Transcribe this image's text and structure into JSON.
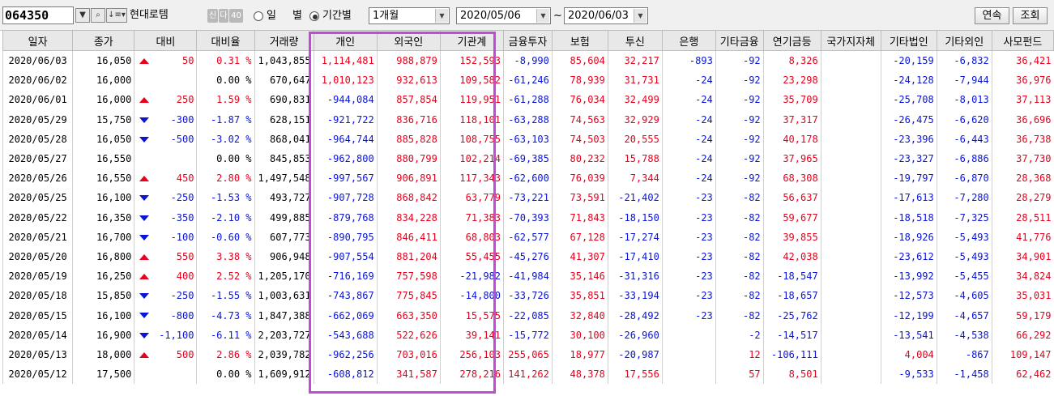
{
  "toolbar": {
    "stock_code": "064350",
    "stock_name": "현대로템",
    "badge_credit": "신",
    "badge_other": "다",
    "badge_margin": "40",
    "radio_daily": "일",
    "radio_daily_suffix": "별",
    "radio_period": "기간별",
    "period_select": "1개월",
    "date_from": "2020/05/06",
    "date_sep": "~",
    "date_to": "2020/06/03",
    "continue_label": "연속",
    "query_label": "조회"
  },
  "columns": [
    "일자",
    "종가",
    "대비",
    "대비율",
    "거래량",
    "개인",
    "외국인",
    "기관계",
    "금융투자",
    "보험",
    "투신",
    "은행",
    "기타금융",
    "연기금등",
    "국가지자체",
    "기타법인",
    "기타외인",
    "사모펀드"
  ],
  "colors": {
    "up": "#e8001c",
    "down": "#0a14d8",
    "highlight": "#c24ad7"
  },
  "rows": [
    {
      "date": "2020/06/03",
      "close": "16,050",
      "dir": "up",
      "diff": "50",
      "rate": "0.31 %",
      "volume": "1,043,855",
      "indiv": "1,114,481",
      "foreign": "988,879",
      "inst": "152,593",
      "fininv": "-8,990",
      "insur": "85,604",
      "trust": "32,217",
      "bank": "-893",
      "etcfin": "-92",
      "pension": "8,326",
      "govt": "",
      "etccorp": "-20,159",
      "etcfor": "-6,832",
      "pef": "36,421"
    },
    {
      "date": "2020/06/02",
      "close": "16,000",
      "dir": "none",
      "diff": "",
      "rate": "0.00 %",
      "volume": "670,647",
      "indiv": "1,010,123",
      "foreign": "932,613",
      "inst": "109,582",
      "fininv": "-61,246",
      "insur": "78,939",
      "trust": "31,731",
      "bank": "-24",
      "etcfin": "-92",
      "pension": "23,298",
      "govt": "",
      "etccorp": "-24,128",
      "etcfor": "-7,944",
      "pef": "36,976"
    },
    {
      "date": "2020/06/01",
      "close": "16,000",
      "dir": "up",
      "diff": "250",
      "rate": "1.59 %",
      "volume": "690,831",
      "indiv": "-944,084",
      "foreign": "857,854",
      "inst": "119,951",
      "fininv": "-61,288",
      "insur": "76,034",
      "trust": "32,499",
      "bank": "-24",
      "etcfin": "-92",
      "pension": "35,709",
      "govt": "",
      "etccorp": "-25,708",
      "etcfor": "-8,013",
      "pef": "37,113"
    },
    {
      "date": "2020/05/29",
      "close": "15,750",
      "dir": "down",
      "diff": "-300",
      "rate": "-1.87 %",
      "volume": "628,151",
      "indiv": "-921,722",
      "foreign": "836,716",
      "inst": "118,101",
      "fininv": "-63,288",
      "insur": "74,563",
      "trust": "32,929",
      "bank": "-24",
      "etcfin": "-92",
      "pension": "37,317",
      "govt": "",
      "etccorp": "-26,475",
      "etcfor": "-6,620",
      "pef": "36,696"
    },
    {
      "date": "2020/05/28",
      "close": "16,050",
      "dir": "down",
      "diff": "-500",
      "rate": "-3.02 %",
      "volume": "868,041",
      "indiv": "-964,744",
      "foreign": "885,828",
      "inst": "108,755",
      "fininv": "-63,103",
      "insur": "74,503",
      "trust": "20,555",
      "bank": "-24",
      "etcfin": "-92",
      "pension": "40,178",
      "govt": "",
      "etccorp": "-23,396",
      "etcfor": "-6,443",
      "pef": "36,738"
    },
    {
      "date": "2020/05/27",
      "close": "16,550",
      "dir": "none",
      "diff": "",
      "rate": "0.00 %",
      "volume": "845,853",
      "indiv": "-962,800",
      "foreign": "880,799",
      "inst": "102,214",
      "fininv": "-69,385",
      "insur": "80,232",
      "trust": "15,788",
      "bank": "-24",
      "etcfin": "-92",
      "pension": "37,965",
      "govt": "",
      "etccorp": "-23,327",
      "etcfor": "-6,886",
      "pef": "37,730"
    },
    {
      "date": "2020/05/26",
      "close": "16,550",
      "dir": "up",
      "diff": "450",
      "rate": "2.80 %",
      "volume": "1,497,548",
      "indiv": "-997,567",
      "foreign": "906,891",
      "inst": "117,343",
      "fininv": "-62,600",
      "insur": "76,039",
      "trust": "7,344",
      "bank": "-24",
      "etcfin": "-92",
      "pension": "68,308",
      "govt": "",
      "etccorp": "-19,797",
      "etcfor": "-6,870",
      "pef": "28,368"
    },
    {
      "date": "2020/05/25",
      "close": "16,100",
      "dir": "down",
      "diff": "-250",
      "rate": "-1.53 %",
      "volume": "493,727",
      "indiv": "-907,728",
      "foreign": "868,842",
      "inst": "63,779",
      "fininv": "-73,221",
      "insur": "73,591",
      "trust": "-21,402",
      "bank": "-23",
      "etcfin": "-82",
      "pension": "56,637",
      "govt": "",
      "etccorp": "-17,613",
      "etcfor": "-7,280",
      "pef": "28,279"
    },
    {
      "date": "2020/05/22",
      "close": "16,350",
      "dir": "down",
      "diff": "-350",
      "rate": "-2.10 %",
      "volume": "499,885",
      "indiv": "-879,768",
      "foreign": "834,228",
      "inst": "71,383",
      "fininv": "-70,393",
      "insur": "71,843",
      "trust": "-18,150",
      "bank": "-23",
      "etcfin": "-82",
      "pension": "59,677",
      "govt": "",
      "etccorp": "-18,518",
      "etcfor": "-7,325",
      "pef": "28,511"
    },
    {
      "date": "2020/05/21",
      "close": "16,700",
      "dir": "down",
      "diff": "-100",
      "rate": "-0.60 %",
      "volume": "607,773",
      "indiv": "-890,795",
      "foreign": "846,411",
      "inst": "68,803",
      "fininv": "-62,577",
      "insur": "67,128",
      "trust": "-17,274",
      "bank": "-23",
      "etcfin": "-82",
      "pension": "39,855",
      "govt": "",
      "etccorp": "-18,926",
      "etcfor": "-5,493",
      "pef": "41,776"
    },
    {
      "date": "2020/05/20",
      "close": "16,800",
      "dir": "up",
      "diff": "550",
      "rate": "3.38 %",
      "volume": "906,948",
      "indiv": "-907,554",
      "foreign": "881,204",
      "inst": "55,455",
      "fininv": "-45,276",
      "insur": "41,307",
      "trust": "-17,410",
      "bank": "-23",
      "etcfin": "-82",
      "pension": "42,038",
      "govt": "",
      "etccorp": "-23,612",
      "etcfor": "-5,493",
      "pef": "34,901"
    },
    {
      "date": "2020/05/19",
      "close": "16,250",
      "dir": "up",
      "diff": "400",
      "rate": "2.52 %",
      "volume": "1,205,170",
      "indiv": "-716,169",
      "foreign": "757,598",
      "inst": "-21,982",
      "fininv": "-41,984",
      "insur": "35,146",
      "trust": "-31,316",
      "bank": "-23",
      "etcfin": "-82",
      "pension": "-18,547",
      "govt": "",
      "etccorp": "-13,992",
      "etcfor": "-5,455",
      "pef": "34,824"
    },
    {
      "date": "2020/05/18",
      "close": "15,850",
      "dir": "down",
      "diff": "-250",
      "rate": "-1.55 %",
      "volume": "1,003,631",
      "indiv": "-743,867",
      "foreign": "775,845",
      "inst": "-14,800",
      "fininv": "-33,726",
      "insur": "35,851",
      "trust": "-33,194",
      "bank": "-23",
      "etcfin": "-82",
      "pension": "-18,657",
      "govt": "",
      "etccorp": "-12,573",
      "etcfor": "-4,605",
      "pef": "35,031"
    },
    {
      "date": "2020/05/15",
      "close": "16,100",
      "dir": "down",
      "diff": "-800",
      "rate": "-4.73 %",
      "volume": "1,847,388",
      "indiv": "-662,069",
      "foreign": "663,350",
      "inst": "15,575",
      "fininv": "-22,085",
      "insur": "32,840",
      "trust": "-28,492",
      "bank": "-23",
      "etcfin": "-82",
      "pension": "-25,762",
      "govt": "",
      "etccorp": "-12,199",
      "etcfor": "-4,657",
      "pef": "59,179"
    },
    {
      "date": "2020/05/14",
      "close": "16,900",
      "dir": "down",
      "diff": "-1,100",
      "rate": "-6.11 %",
      "volume": "2,203,727",
      "indiv": "-543,688",
      "foreign": "522,626",
      "inst": "39,141",
      "fininv": "-15,772",
      "insur": "30,100",
      "trust": "-26,960",
      "bank": "",
      "etcfin": "-2",
      "pension": "-14,517",
      "govt": "",
      "etccorp": "-13,541",
      "etcfor": "-4,538",
      "pef": "66,292"
    },
    {
      "date": "2020/05/13",
      "close": "18,000",
      "dir": "up",
      "diff": "500",
      "rate": "2.86 %",
      "volume": "2,039,782",
      "indiv": "-962,256",
      "foreign": "703,016",
      "inst": "256,103",
      "fininv": "255,065",
      "insur": "18,977",
      "trust": "-20,987",
      "bank": "",
      "etcfin": "12",
      "pension": "-106,111",
      "govt": "",
      "etccorp": "4,004",
      "etcfor": "-867",
      "pef": "109,147"
    },
    {
      "date": "2020/05/12",
      "close": "17,500",
      "dir": "none",
      "diff": "",
      "rate": "0.00 %",
      "volume": "1,609,912",
      "indiv": "-608,812",
      "foreign": "341,587",
      "inst": "278,216",
      "fininv": "141,262",
      "insur": "48,378",
      "trust": "17,556",
      "bank": "",
      "etcfin": "57",
      "pension": "8,501",
      "govt": "",
      "etccorp": "-9,533",
      "etcfor": "-1,458",
      "pef": "62,462"
    }
  ]
}
